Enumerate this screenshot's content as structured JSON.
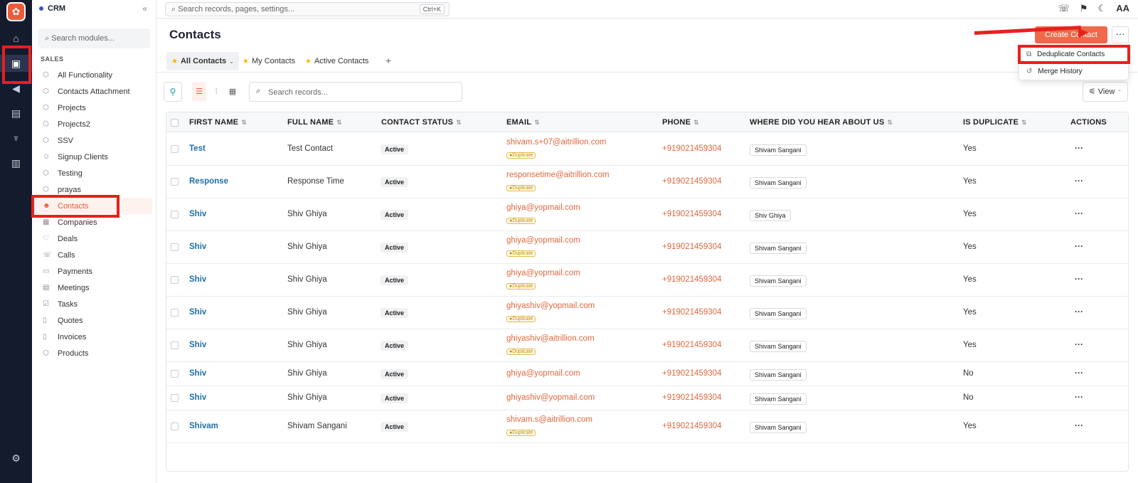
{
  "rail": {
    "logo": "✿",
    "icons": [
      "home-icon",
      "briefcase-icon",
      "megaphone-icon",
      "inbox-icon",
      "rocket-icon",
      "chart-icon",
      "gear-icon"
    ]
  },
  "sidebar": {
    "app_name": "CRM",
    "collapse": "«",
    "search_placeholder": "Search modules...",
    "section": "SALES",
    "items": [
      {
        "label": "All Functionality",
        "icon": "cube-icon"
      },
      {
        "label": "Contacts Attachment",
        "icon": "cube-icon"
      },
      {
        "label": "Projects",
        "icon": "cube-icon"
      },
      {
        "label": "Projects2",
        "icon": "cube-icon"
      },
      {
        "label": "SSV",
        "icon": "cube-icon"
      },
      {
        "label": "Signup Clients",
        "icon": "person-icon"
      },
      {
        "label": "Testing",
        "icon": "cube-icon"
      },
      {
        "label": "prayas",
        "icon": "cube-icon"
      },
      {
        "label": "Contacts",
        "icon": "people-icon"
      },
      {
        "label": "Companies",
        "icon": "building-icon"
      },
      {
        "label": "Deals",
        "icon": "handshake-icon"
      },
      {
        "label": "Calls",
        "icon": "phone-icon"
      },
      {
        "label": "Payments",
        "icon": "card-icon"
      },
      {
        "label": "Meetings",
        "icon": "calendar-icon"
      },
      {
        "label": "Tasks",
        "icon": "task-icon"
      },
      {
        "label": "Quotes",
        "icon": "doc-icon"
      },
      {
        "label": "Invoices",
        "icon": "doc-icon"
      },
      {
        "label": "Products",
        "icon": "cube-icon"
      }
    ]
  },
  "topbar": {
    "search_placeholder": "Search records, pages, settings...",
    "shortcut": "Ctrl+K",
    "right": [
      "☏",
      "⚑",
      "☾",
      "AA"
    ]
  },
  "page": {
    "title": "Contacts",
    "create_label": "Create Contact",
    "more_label": "···",
    "tabs": [
      "All Contacts",
      "My Contacts",
      "Active Contacts"
    ],
    "add_tab": "+",
    "menu": [
      {
        "label": "Deduplicate Contacts",
        "icon": "copy-icon"
      },
      {
        "label": "Merge History",
        "icon": "history-icon"
      }
    ],
    "records_placeholder": "Search records...",
    "view_label": "View"
  },
  "table": {
    "columns": [
      "FIRST NAME",
      "FULL NAME",
      "CONTACT STATUS",
      "EMAIL",
      "PHONE",
      "WHERE DID YOU HEAR ABOUT US",
      "IS DUPLICATE",
      "ACTIONS"
    ],
    "duplicate_badge": "●Duplicate",
    "action_label": "···",
    "rows": [
      {
        "first": "Test",
        "full": "Test Contact",
        "status": "Active",
        "email": "shivam.s+07@aitrillion.com",
        "dup": true,
        "phone": "+919021459304",
        "source": "Shivam Sangani",
        "is_dup": "Yes"
      },
      {
        "first": "Response",
        "full": "Response Time",
        "status": "Active",
        "email": "responsetime@aitrillion.com",
        "dup": true,
        "phone": "+919021459304",
        "source": "Shivam Sangani",
        "is_dup": "Yes"
      },
      {
        "first": "Shiv",
        "full": "Shiv Ghiya",
        "status": "Active",
        "email": "ghiya@yopmail.com",
        "dup": true,
        "phone": "+919021459304",
        "source": "Shiv Ghiya",
        "is_dup": "Yes"
      },
      {
        "first": "Shiv",
        "full": "Shiv Ghiya",
        "status": "Active",
        "email": "ghiya@yopmail.com",
        "dup": true,
        "phone": "+919021459304",
        "source": "Shivam Sangani",
        "is_dup": "Yes"
      },
      {
        "first": "Shiv",
        "full": "Shiv Ghiya",
        "status": "Active",
        "email": "ghiya@yopmail.com",
        "dup": true,
        "phone": "+919021459304",
        "source": "Shivam Sangani",
        "is_dup": "Yes"
      },
      {
        "first": "Shiv",
        "full": "Shiv Ghiya",
        "status": "Active",
        "email": "ghiyashiv@yopmail.com",
        "dup": true,
        "phone": "+919021459304",
        "source": "Shivam Sangani",
        "is_dup": "Yes"
      },
      {
        "first": "Shiv",
        "full": "Shiv Ghiya",
        "status": "Active",
        "email": "ghiyashiv@aitrillion.com",
        "dup": true,
        "phone": "+919021459304",
        "source": "Shivam Sangani",
        "is_dup": "Yes"
      },
      {
        "first": "Shiv",
        "full": "Shiv Ghiya",
        "status": "Active",
        "email": "ghiya@yopmail.com",
        "dup": false,
        "phone": "+919021459304",
        "source": "Shivam Sangani",
        "is_dup": "No"
      },
      {
        "first": "Shiv",
        "full": "Shiv Ghiya",
        "status": "Active",
        "email": "ghiyashiv@yopmail.com",
        "dup": false,
        "phone": "+919021459304",
        "source": "Shivam Sangani",
        "is_dup": "No"
      },
      {
        "first": "Shivam",
        "full": "Shivam Sangani",
        "status": "Active",
        "email": "shivam.s@aitrillion.com",
        "dup": true,
        "phone": "+919021459304",
        "source": "Shivam Sangani",
        "is_dup": "Yes"
      }
    ]
  },
  "colors": {
    "accent": "#ef5a39",
    "highlight": "#e8201d",
    "link": "#1c6fa7"
  }
}
